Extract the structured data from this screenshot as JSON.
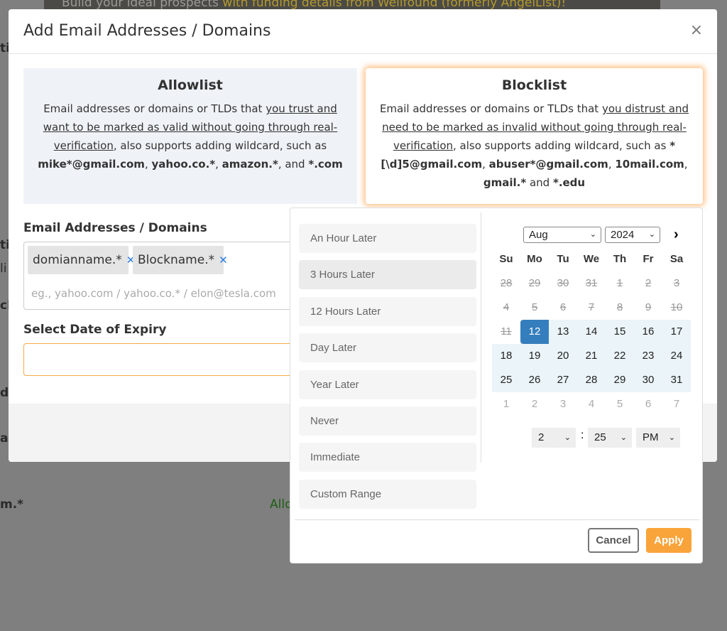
{
  "background": {
    "banner_text": "Build your ideal prospects ",
    "banner_highlight": "with funding details from Wellfound (formerly AngelList)!",
    "fragments": [
      "ti",
      "li",
      "cl",
      "d",
      "au",
      "m.*",
      "Allo"
    ]
  },
  "modal": {
    "title": "Add Email Addresses / Domains",
    "close": "×",
    "allowlist": {
      "title": "Allowlist",
      "text_pre": "Email addresses or domains or TLDs that ",
      "text_underline": " you trust and want to be marked as valid without going through real-verification",
      "text_post": ", also supports adding wildcard, such as ",
      "examples": [
        "mike*@gmail.com",
        "yahoo.co.*",
        "amazon.*",
        "*.com"
      ]
    },
    "blocklist": {
      "title": "Blocklist",
      "text_pre": "Email addresses or domains or TLDs that ",
      "text_underline": " you distrust and need to be marked as invalid without going through real-verification",
      "text_post": ", also supports adding wildcard, such as ",
      "examples": [
        "*[\\d]5@gmail.com",
        "abuser*@gmail.com",
        "10mail.com",
        "gmail.*",
        "*.edu"
      ]
    },
    "emails_label": "Email Addresses / Domains",
    "tags": [
      "domianname.*",
      "Blockname.*"
    ],
    "placeholder": "eg., yahoo.com / yahoo.co.* / elon@tesla.com",
    "expiry_label": "Select Date of Expiry",
    "expiry_value": ""
  },
  "picker": {
    "ranges": [
      "An Hour Later",
      "3 Hours Later",
      "12 Hours Later",
      "Day Later",
      "Year Later",
      "Never",
      "Immediate",
      "Custom Range"
    ],
    "hovered_range": "3 Hours Later",
    "month": "Aug",
    "year": "2024",
    "next": "›",
    "weekdays": [
      "Su",
      "Mo",
      "Tu",
      "We",
      "Th",
      "Fr",
      "Sa"
    ],
    "weeks": [
      [
        28,
        29,
        30,
        31,
        1,
        2,
        3
      ],
      [
        4,
        5,
        6,
        7,
        8,
        9,
        10
      ],
      [
        11,
        12,
        13,
        14,
        15,
        16,
        17
      ],
      [
        18,
        19,
        20,
        21,
        22,
        23,
        24
      ],
      [
        25,
        26,
        27,
        28,
        29,
        30,
        31
      ],
      [
        1,
        2,
        3,
        4,
        5,
        6,
        7
      ]
    ],
    "selected_day": 12,
    "hour": "2",
    "minute": "25",
    "ampm": "PM",
    "cancel": "Cancel",
    "apply": "Apply",
    "colors": {
      "accent": "#f9a43a",
      "selected": "#357ebd",
      "range_bg": "#ebf4f8"
    }
  }
}
